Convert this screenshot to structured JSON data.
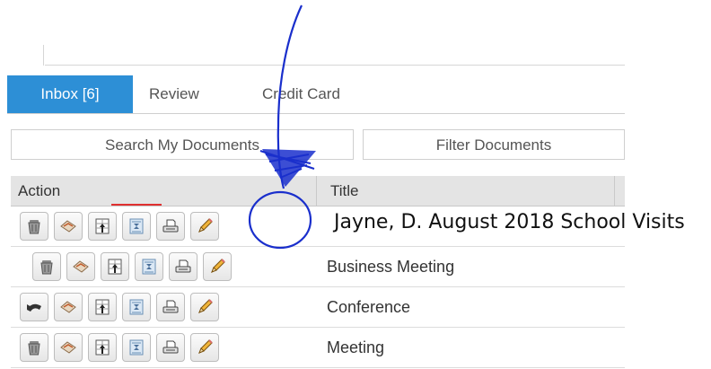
{
  "tabs": [
    {
      "label": "Inbox [6]",
      "active": true
    },
    {
      "label": "Review",
      "active": false
    },
    {
      "label": "Credit Card",
      "active": false
    }
  ],
  "search_button": "Search My Documents",
  "filter_button": "Filter Documents",
  "columns": {
    "action": "Action",
    "title": "Title"
  },
  "rows": [
    {
      "title": "Jayne, D. August 2018 School Visits",
      "first_icon": "trash-icon"
    },
    {
      "title": "Business Meeting",
      "first_icon": "trash-icon"
    },
    {
      "title": "Conference",
      "first_icon": "undo-arrow-icon"
    },
    {
      "title": "Meeting",
      "first_icon": "trash-icon"
    }
  ],
  "action_icons": [
    "hand-forward-icon",
    "document-upload-icon",
    "hourglass-doc-icon",
    "print-icon",
    "pencil-edit-icon"
  ],
  "colors": {
    "tab_active": "#2d8fd6",
    "annotation_ink": "#1a2fcc",
    "header_bg": "#e4e4e4"
  }
}
